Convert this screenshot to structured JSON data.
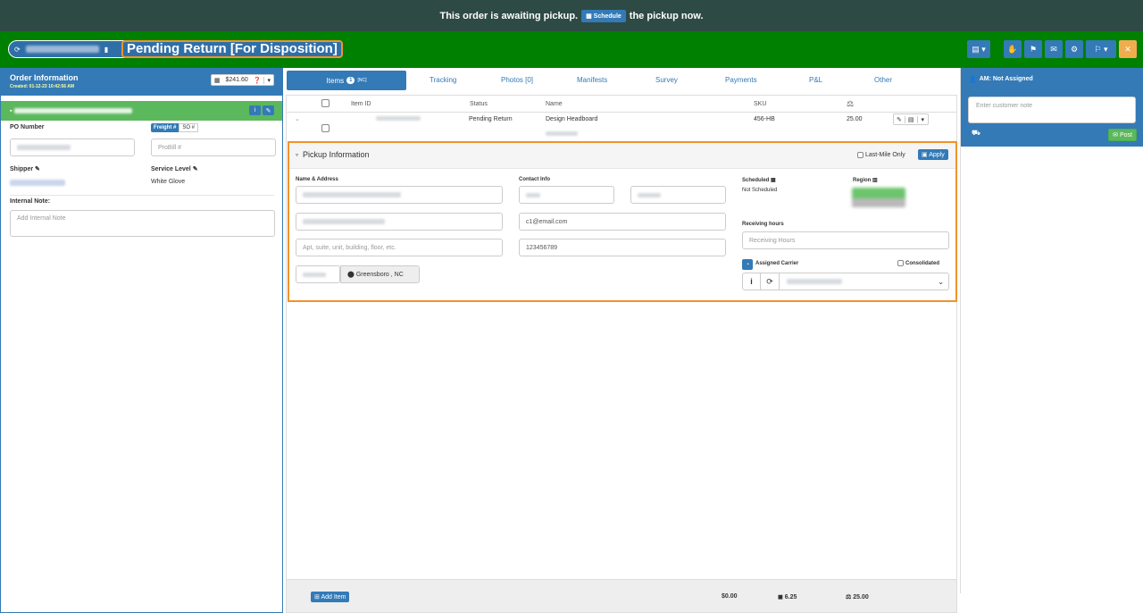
{
  "banner": {
    "pre": "This order is awaiting pickup.",
    "schedule_btn": "Schedule",
    "post": "the pickup now."
  },
  "header": {
    "status_title": "Pending Return [For Disposition]"
  },
  "order_info": {
    "title": "Order Information",
    "created": "Created: 01-12-23 10:42:56 AM",
    "price": "$241.60",
    "po_label": "PO Number",
    "freight_tab": "Freight #",
    "so_tab": "SO #",
    "probill_placeholder": "ProBill #",
    "shipper_label": "Shipper",
    "service_level_label": "Service Level",
    "service_level_value": "White Glove",
    "internal_note_label": "Internal Note:",
    "internal_note_placeholder": "Add Internal Note"
  },
  "tabs": {
    "items": "Items",
    "items_count": "1",
    "items_sup": "[NC]",
    "tracking": "Tracking",
    "photos": "Photos [0]",
    "manifests": "Manifests",
    "survey": "Survey",
    "payments": "Payments",
    "pl": "P&L",
    "other": "Other"
  },
  "table": {
    "headers": {
      "item_id": "Item ID",
      "status": "Status",
      "name": "Name",
      "sku": "SKU"
    },
    "row": {
      "status": "Pending Return",
      "name": "Design Headboard",
      "sku": "456-HB",
      "weight": "25.00"
    }
  },
  "pickup": {
    "title": "Pickup Information",
    "last_mile": "Last-Mile Only",
    "apply": "Apply",
    "name_addr_label": "Name & Address",
    "address2_placeholder": "Apt, suite, unit, building, floor, etc.",
    "city": "Greensboro , NC",
    "contact_label": "Contact Info",
    "email": "c1@email.com",
    "phone": "123456789",
    "scheduled_label": "Scheduled",
    "scheduled_value": "Not Scheduled",
    "region_label": "Region",
    "receiving_label": "Receiving hours",
    "receiving_placeholder": "Receiving Hours",
    "carrier_label": "Assigned Carrier",
    "consolidated": "Consolidated"
  },
  "footer": {
    "add_item": "Add Item",
    "total": "$0.00",
    "cube": "6.25",
    "weight": "25.00"
  },
  "right": {
    "am": "AM: Not Assigned",
    "note_placeholder": "Enter customer note",
    "post": "Post"
  }
}
